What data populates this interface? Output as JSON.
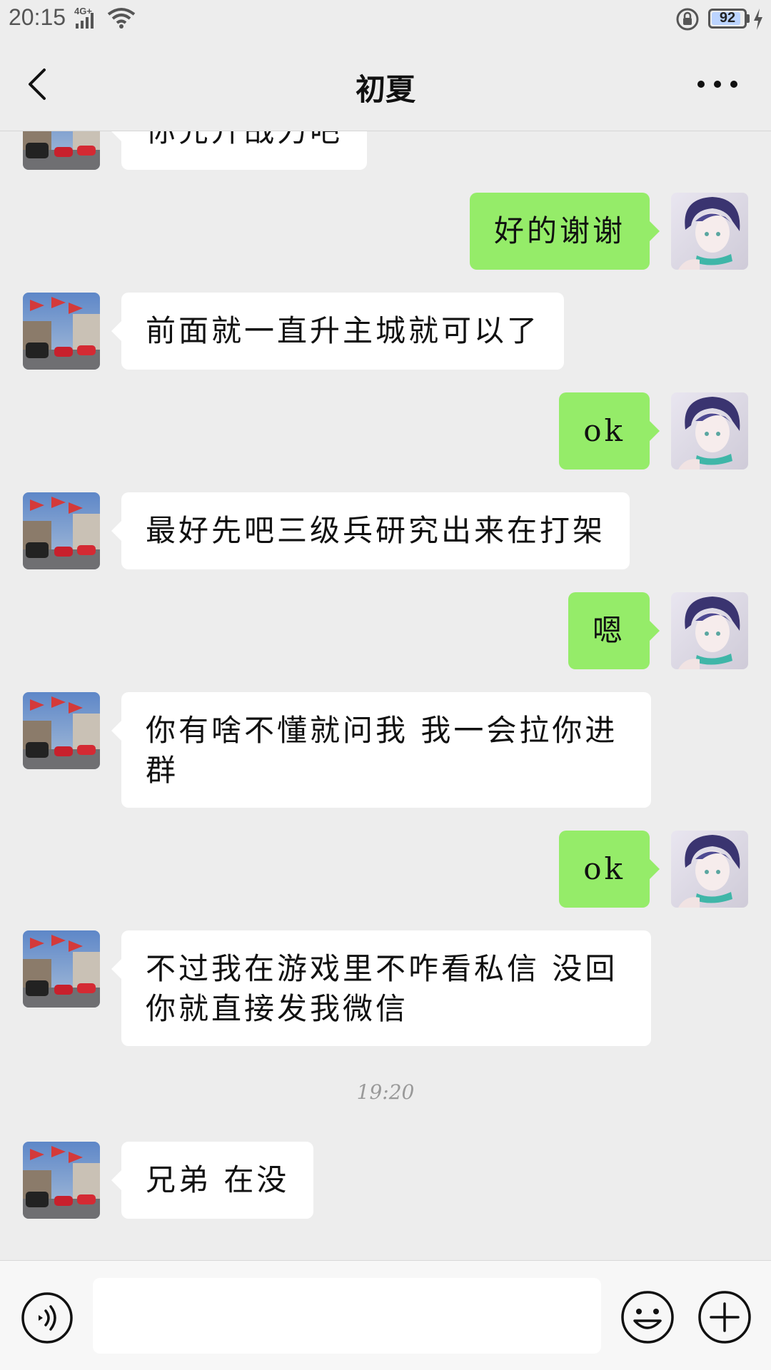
{
  "status_bar": {
    "time": "20:15",
    "network": "4G+",
    "battery_level": "92"
  },
  "header": {
    "title": "初夏"
  },
  "messages": [
    {
      "side": "left",
      "text": "你先升战力吧"
    },
    {
      "side": "right",
      "text": "好的谢谢"
    },
    {
      "side": "left",
      "text": "前面就一直升主城就可以了"
    },
    {
      "side": "right",
      "text": "ok"
    },
    {
      "side": "left",
      "text": "最好先吧三级兵研究出来在打架"
    },
    {
      "side": "right",
      "text": "嗯"
    },
    {
      "side": "left",
      "text": "你有啥不懂就问我 我一会拉你进群"
    },
    {
      "side": "right",
      "text": "ok"
    },
    {
      "side": "left",
      "text": "不过我在游戏里不咋看私信 没回你就直接发我微信"
    },
    {
      "side": "left",
      "text": "兄弟 在没"
    }
  ],
  "timestamps": [
    "19:20"
  ],
  "input": {
    "value": "",
    "placeholder": ""
  },
  "icons": {
    "back": "chevron-left-icon",
    "more": "more-dots-icon",
    "voice": "voice-icon",
    "emoji": "emoji-icon",
    "plus": "plus-icon"
  },
  "colors": {
    "bubble_sent": "#95ec69",
    "bubble_received": "#ffffff",
    "background": "#ededed"
  }
}
